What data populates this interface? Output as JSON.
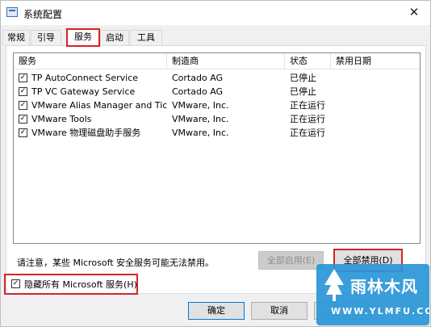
{
  "window": {
    "title": "系统配置",
    "close_icon": "close-icon"
  },
  "tabs": [
    {
      "label": "常规"
    },
    {
      "label": "引导"
    },
    {
      "label": "服务",
      "active": true
    },
    {
      "label": "启动"
    },
    {
      "label": "工具"
    }
  ],
  "services": {
    "columns": [
      "服务",
      "制造商",
      "状态",
      "禁用日期"
    ],
    "rows": [
      {
        "checked": true,
        "name": "TP AutoConnect Service",
        "maker": "Cortado AG",
        "status": "已停止",
        "date": ""
      },
      {
        "checked": true,
        "name": "TP VC Gateway Service",
        "maker": "Cortado AG",
        "status": "已停止",
        "date": ""
      },
      {
        "checked": true,
        "name": "VMware Alias Manager and Tick...",
        "maker": "VMware, Inc.",
        "status": "正在运行",
        "date": ""
      },
      {
        "checked": true,
        "name": "VMware Tools",
        "maker": "VMware, Inc.",
        "status": "正在运行",
        "date": ""
      },
      {
        "checked": true,
        "name": "VMware 物理磁盘助手服务",
        "maker": "VMware, Inc.",
        "status": "正在运行",
        "date": ""
      }
    ]
  },
  "note": "请注意，某些 Microsoft 安全服务可能无法禁用。",
  "buttons": {
    "enable_all": "全部启用(E)",
    "disable_all": "全部禁用(D)",
    "ok": "确定",
    "cancel": "取消"
  },
  "hide_ms": {
    "checked": true,
    "label": "隐藏所有 Microsoft 服务(H)"
  },
  "watermark": {
    "name": "雨林木风",
    "url": "WWW.YLMFU.COM"
  },
  "colors": {
    "highlight": "#d6232a",
    "watermark_bg": "#2896d7"
  }
}
